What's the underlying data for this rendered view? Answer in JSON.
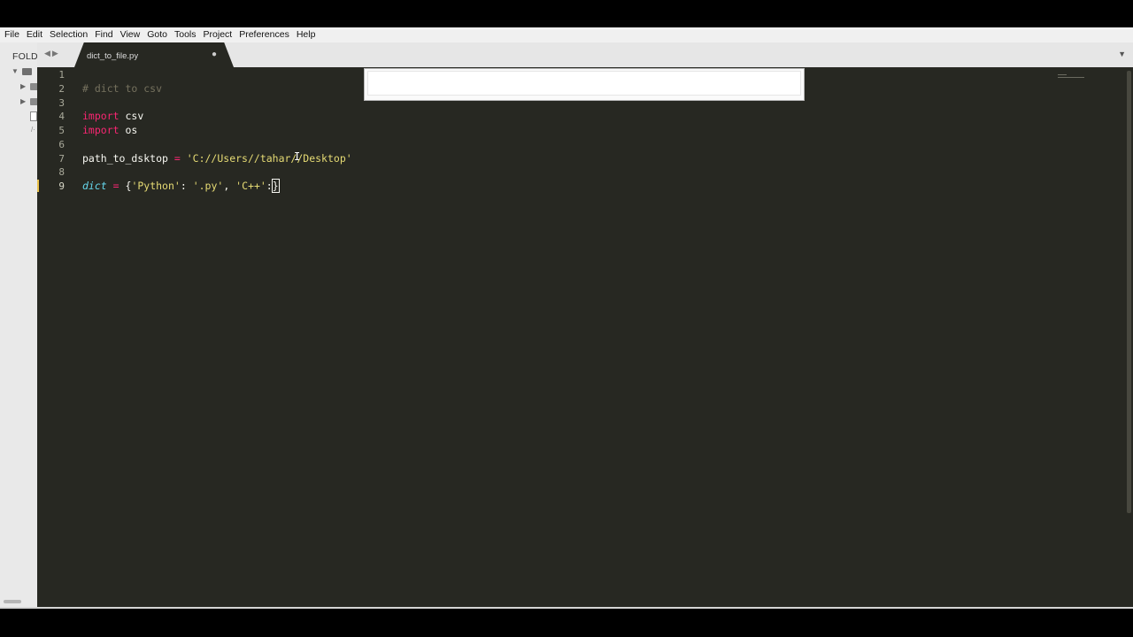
{
  "menu": [
    "File",
    "Edit",
    "Selection",
    "Find",
    "View",
    "Goto",
    "Tools",
    "Project",
    "Preferences",
    "Help"
  ],
  "sidebar": {
    "title": "FOLD"
  },
  "tab": {
    "label": "dict_to_file.py"
  },
  "editor": {
    "line_numbers": [
      "1",
      "2",
      "3",
      "4",
      "5",
      "6",
      "7",
      "8",
      "9"
    ],
    "active_line": 9,
    "lines": {
      "l2_comment": "# dict to csv",
      "l4_kw": "import",
      "l4_rest": " csv",
      "l5_kw": "import",
      "l5_rest": " os",
      "l7_var": "path_to_dsktop ",
      "l7_op": "=",
      "l7_sp": " ",
      "l7_str": "'C://Users//tahar//Desktop'",
      "l9_var": "dict",
      "l9_sp1": " ",
      "l9_op": "=",
      "l9_brace": " {",
      "l9_s1": "'Python'",
      "l9_c1": ": ",
      "l9_s2": "'.py'",
      "l9_c2": ", ",
      "l9_s3": "'C++'",
      "l9_c3": ":",
      "l9_close": "}"
    }
  },
  "colors": {
    "editor_bg": "#272822",
    "keyword": "#f92672",
    "string": "#e6db74",
    "comment": "#75715e",
    "builtin": "#66d9ef"
  },
  "icons": [
    "folder-icon",
    "file-icon",
    "tab-dirty-dot-icon",
    "dropdown-icon",
    "nav-back-icon",
    "nav-forward-icon"
  ]
}
